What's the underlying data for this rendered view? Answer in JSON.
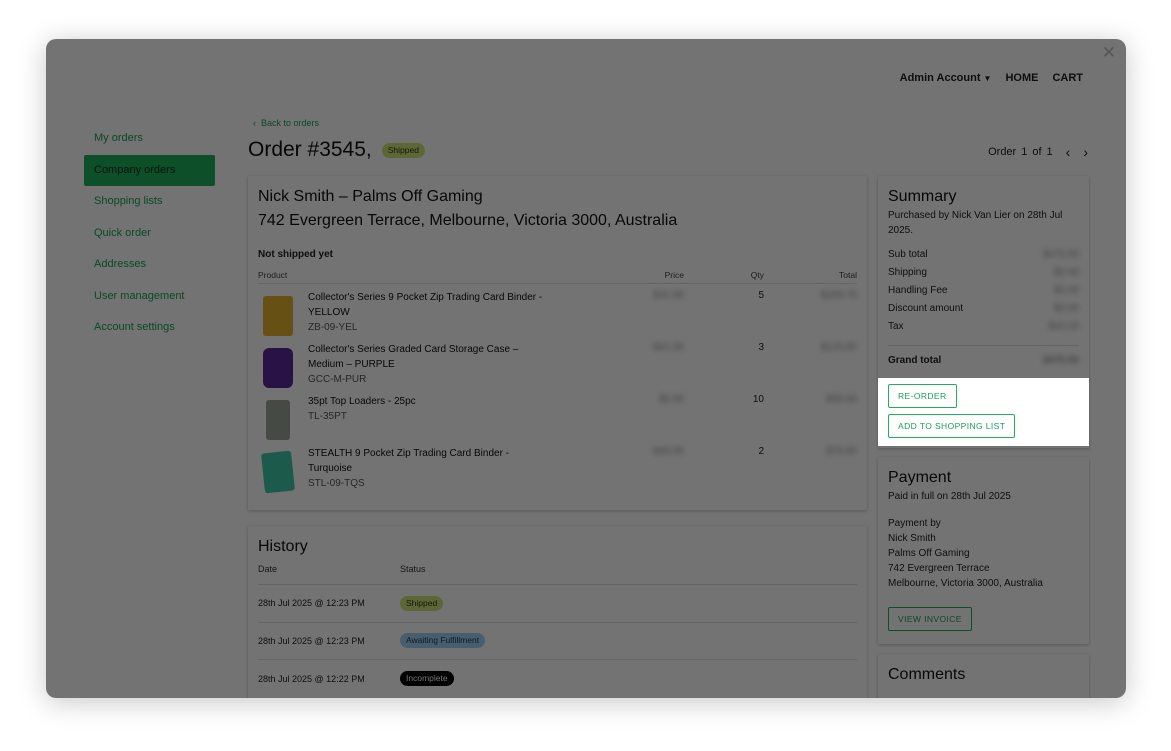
{
  "topnav": {
    "account": "Admin Account",
    "home": "HOME",
    "cart": "CART"
  },
  "sidebar": {
    "items": [
      {
        "label": "My orders"
      },
      {
        "label": "Company orders"
      },
      {
        "label": "Shopping lists"
      },
      {
        "label": "Quick order"
      },
      {
        "label": "Addresses"
      },
      {
        "label": "User management"
      },
      {
        "label": "Account settings"
      }
    ]
  },
  "back_link": "Back to orders",
  "order": {
    "title": "Order #3545,",
    "status": "Shipped"
  },
  "pager": {
    "label": "Order",
    "current": "1",
    "of": "of",
    "total": "1"
  },
  "customer": {
    "name": "Nick Smith – Palms Off Gaming",
    "address": "742 Evergreen Terrace, Melbourne, Victoria 3000, Australia"
  },
  "shipment_status": "Not shipped yet",
  "table": {
    "headers": {
      "product": "Product",
      "price": "Price",
      "qty": "Qty",
      "total": "Total"
    },
    "rows": [
      {
        "name": "Collector's Series 9 Pocket Zip Trading Card Binder - YELLOW",
        "sku": "ZB-09-YEL",
        "price": "$41.95",
        "qty": "5",
        "total": "$209.75",
        "color": "#e4b22a"
      },
      {
        "name": "Collector's Series Graded Card Storage Case – Medium – PURPLE",
        "sku": "GCC-M-PUR",
        "price": "$41.95",
        "qty": "3",
        "total": "$125.85",
        "color": "#5b2a9c"
      },
      {
        "name": "35pt Top Loaders - 25pc",
        "sku": "TL-35PT",
        "price": "$5.95",
        "qty": "10",
        "total": "$59.50",
        "color": "#9aa59a"
      },
      {
        "name": "STEALTH 9 Pocket Zip Trading Card Binder - Turquoise",
        "sku": "STL-09-TQS",
        "price": "$39.95",
        "qty": "2",
        "total": "$79.90",
        "color": "#3fc9a6"
      }
    ]
  },
  "history": {
    "title": "History",
    "headers": {
      "date": "Date",
      "status": "Status"
    },
    "rows": [
      {
        "date": "28th Jul 2025 @ 12:23 PM",
        "status": "Shipped"
      },
      {
        "date": "28th Jul 2025 @ 12:23 PM",
        "status": "Awaiting Fulfillment"
      },
      {
        "date": "28th Jul 2025 @ 12:22 PM",
        "status": "Incomplete"
      }
    ]
  },
  "summary": {
    "title": "Summary",
    "purchased": "Purchased by Nick Van Lier on 28th Jul 2025.",
    "lines": [
      {
        "label": "Sub total",
        "value": "$475.00"
      },
      {
        "label": "Shipping",
        "value": "$0.00"
      },
      {
        "label": "Handling Fee",
        "value": "$0.00"
      },
      {
        "label": "Discount amount",
        "value": "$0.00"
      },
      {
        "label": "Tax",
        "value": "$43.18"
      }
    ],
    "grand_label": "Grand total",
    "grand_value": "$475.00",
    "reorder": "RE-ORDER",
    "add_list": "ADD TO SHOPPING LIST"
  },
  "payment": {
    "title": "Payment",
    "paid": "Paid in full on 28th Jul 2025",
    "by_label": "Payment by",
    "name": "Nick Smith",
    "company": "Palms Off Gaming",
    "street": "742 Evergreen Terrace",
    "city": "Melbourne, Victoria 3000, Australia",
    "invoice": "VIEW INVOICE"
  },
  "comments": {
    "title": "Comments"
  },
  "colors": {
    "accent": "#1eb05a",
    "shipped": "#cfe27a",
    "awaiting": "#9fd0f7",
    "incomplete": "#000000"
  }
}
